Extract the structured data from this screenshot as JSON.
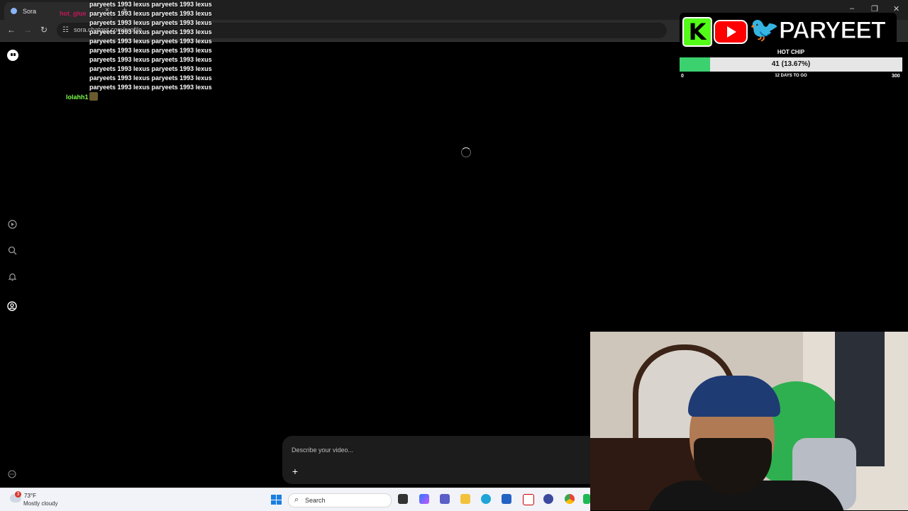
{
  "browser": {
    "tab_title": "Sora",
    "tab_close": "×",
    "new_tab": "+",
    "url": "sora.chatgpt.com/profile",
    "back": "←",
    "forward": "→",
    "reload": "↻",
    "site_info": "☷",
    "menu": "⋮",
    "minimize": "–",
    "maximize": "❐",
    "close": "✕"
  },
  "chat": {
    "top_user": "hot_glue",
    "repeated_line": "paryeets 1993 lexus paryeets 1993 lexus",
    "lines": [
      "paryeets 1993 lexus paryeets 1993 lexus",
      "paryeets 1993 lexus paryeets 1993 lexus",
      "paryeets 1993 lexus paryeets 1993 lexus",
      "paryeets 1993 lexus paryeets 1993 lexus",
      "paryeets 1993 lexus paryeets 1993 lexus",
      "paryeets 1993 lexus paryeets 1993 lexus",
      "paryeets 1993 lexus paryeets 1993 lexus",
      "paryeets 1993 lexus paryeets 1993 lexus",
      "paryeets 1993 lexus paryeets 1993 lexus",
      "paryeets 1993 lexus paryeets 1993 lexus"
    ],
    "second_user": "lolahh1"
  },
  "sidebar": {
    "icons": [
      "sora-logo-icon",
      "play-icon",
      "search-icon",
      "bell-icon",
      "profile-icon",
      "settings-icon"
    ]
  },
  "prompt": {
    "placeholder": "Describe your video...",
    "add_label": "+"
  },
  "overlay": {
    "brand": "PARYEET",
    "kick_letter": "K",
    "twitter_glyph": "🐦",
    "goal_title": "HOT CHIP",
    "goal_text": "41 (13.67%)",
    "goal_fraction": 0.1367,
    "goal_min": "0",
    "goal_days": "12 DAYS TO GO",
    "goal_max": "300",
    "colors": {
      "kick": "#53fc18",
      "youtube": "#ff0000",
      "twitter": "#1d9bf0",
      "goal_fill": "#3bd16f"
    }
  },
  "taskbar": {
    "weather_badge": "3",
    "temperature": "73°F",
    "condition": "Mostly cloudy",
    "search_label": "Search",
    "search_icon": "⌕"
  }
}
